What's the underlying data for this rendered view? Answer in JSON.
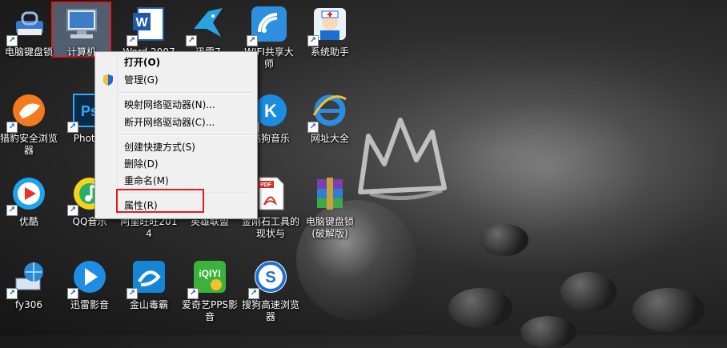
{
  "desktop": {
    "icons": [
      {
        "label": "电脑键盘锁"
      },
      {
        "label": "计算机"
      },
      {
        "label": "Word 2007"
      },
      {
        "label": "迅雷7"
      },
      {
        "label": "WIFI共享大师"
      },
      {
        "label": "系统助手"
      },
      {
        "label": "猎豹安全浏览器"
      },
      {
        "label": "Photos"
      },
      {
        "label": "酷狗音乐"
      },
      {
        "label": "网址大全"
      },
      {
        "label": "优酷"
      },
      {
        "label": "QQ音乐"
      },
      {
        "label": "阿里旺旺2014"
      },
      {
        "label": "英雄联盟"
      },
      {
        "label": "金刚石工具的现状与"
      },
      {
        "label": "电脑键盘锁(破解版)"
      },
      {
        "label": "fy306"
      },
      {
        "label": "迅雷影音"
      },
      {
        "label": "金山毒霸"
      },
      {
        "label": "爱奇艺PPS影音"
      },
      {
        "label": "搜狗高速浏览器"
      }
    ]
  },
  "context_menu": {
    "open": "打开(O)",
    "manage": "管理(G)",
    "map_drive": "映射网络驱动器(N)...",
    "disconnect_drive": "断开网络驱动器(C)...",
    "create_shortcut": "创建快捷方式(S)",
    "delete": "删除(D)",
    "rename": "重命名(M)",
    "properties": "属性(R)"
  }
}
